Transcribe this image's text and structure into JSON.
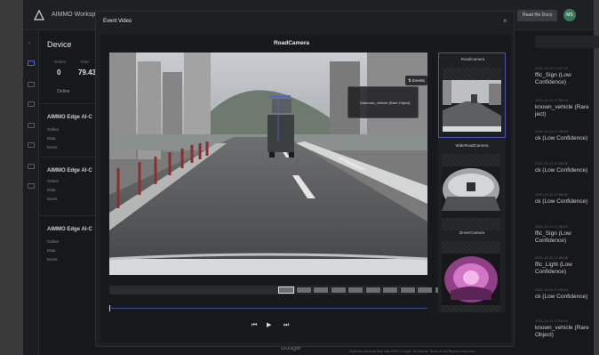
{
  "app": {
    "title": "AIMMO Workspac",
    "read_docs": "Read the Docs",
    "user_initials": "MS"
  },
  "device": {
    "heading": "Device",
    "stats": [
      {
        "label": "Online",
        "value": "0"
      },
      {
        "label": "Total",
        "value": "79.43"
      }
    ],
    "online_label": "Online",
    "cards": [
      {
        "title": "AIMMO Edge AI-C",
        "rows": [
          "Online",
          "Data",
          "Event"
        ]
      },
      {
        "title": "AIMMO Edge AI-C",
        "rows": [
          "Online",
          "Data",
          "Event"
        ]
      },
      {
        "title": "AIMMO Edge AI-C",
        "rows": [
          "Online",
          "Data",
          "Event"
        ]
      }
    ]
  },
  "events_list": [
    {
      "time": "2021-10-11 17:07:12",
      "title": "ffic_Sign (Low Confidence)"
    },
    {
      "time": "2021-10-11 17:06:44",
      "title": "known_vehicle (Rare ject)"
    },
    {
      "time": "2021-10-11 17:06:59",
      "title": "ck (Low Confidence)"
    },
    {
      "time": "2021-10-11 17:06:32",
      "title": "ck (Low Confidence)"
    },
    {
      "time": "2021-10-11 17:06:30",
      "title": "ck (Low Confidence)"
    },
    {
      "time": "2021-10-11 17:06:20",
      "title": "ffic_Sign (Low Confidence)"
    },
    {
      "time": "2021-10-11 17:06:05",
      "title": "ffic_Light (Low Confidence)"
    },
    {
      "time": "2021-10-11 17:05:59",
      "title": "ck (Low Confidence)"
    },
    {
      "time": "2021-10-11 17:05:44",
      "title": "known_vehicle (Rare Object)"
    }
  ],
  "map": {
    "provider": "Google",
    "attribution": "Keyboard shortcuts   Map data ©2021 Google, SK telecom   Terms of Use   Report a map error"
  },
  "modal": {
    "title": "Event Video",
    "close": "×",
    "camera_title": "RoadCamera",
    "events_button": "Events",
    "event_tag": "Unknown_vehicle (Rare Object)",
    "thumbnail_count": 10,
    "active_thumbnail": 1,
    "playback_position": 0.0,
    "controls": {
      "prev": "⏮",
      "play": "▶",
      "next": "⏭"
    },
    "side_cameras": [
      {
        "label": "RoadCamera",
        "selected": true
      },
      {
        "label": "WideRoadCamera",
        "selected": false
      },
      {
        "label": "DriverCamera",
        "selected": false
      }
    ]
  },
  "colors": {
    "accent": "#4a56b8",
    "avatar": "#3a7a56",
    "driver_cam": "#d476c8"
  }
}
